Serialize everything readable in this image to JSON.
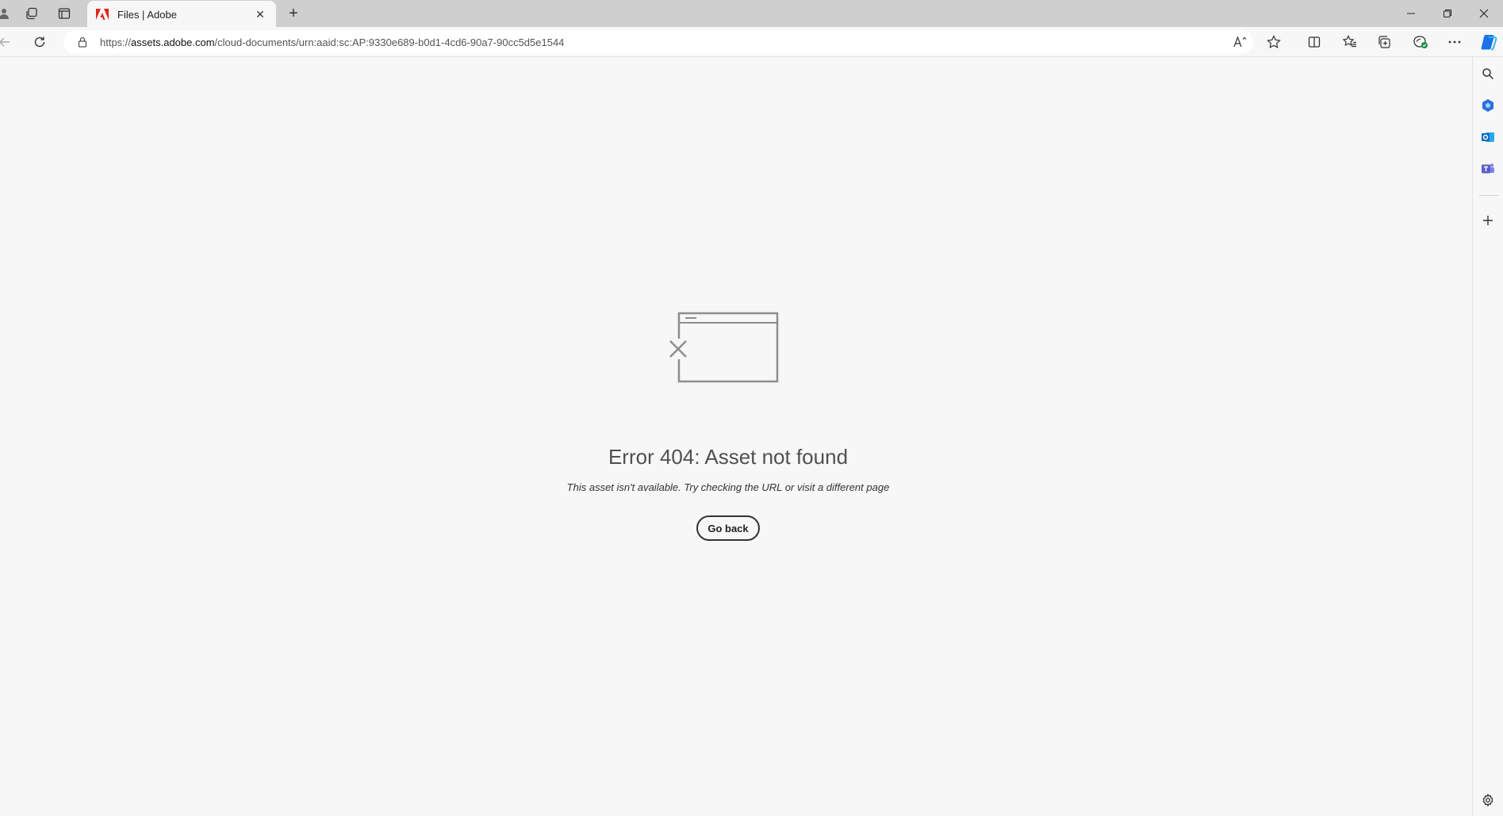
{
  "browser": {
    "tab": {
      "title": "Files | Adobe",
      "favicon": "adobe-icon"
    },
    "window_controls": [
      "minimize-icon",
      "restore-icon",
      "close-icon"
    ],
    "address": {
      "scheme": "https://",
      "host": "assets.adobe.com",
      "path": "/cloud-documents/urn:aaid:sc:AP:9330e689-b0d1-4cd6-90a7-90cc5d5e1544"
    },
    "toolbar_icons": [
      "read-aloud-icon",
      "favorite-star-icon",
      "split-screen-icon",
      "favorites-icon",
      "collections-icon",
      "browser-essentials-icon",
      "more-icon",
      "copilot-icon"
    ],
    "sidebar_icons": [
      "search-icon",
      "copilot-apps-icon",
      "outlook-icon",
      "teams-icon",
      "add-icon",
      "settings-icon"
    ]
  },
  "page": {
    "error_title": "Error 404: Asset not found",
    "error_message": "This asset isn't available. Try checking the URL or visit a different page",
    "go_back_label": "Go back"
  },
  "colors": {
    "adobe_red": "#e1251b",
    "copilot_blue": "#1a73e8",
    "outlook_blue": "#0f6cbd",
    "teams_purple": "#5b5fc7"
  }
}
